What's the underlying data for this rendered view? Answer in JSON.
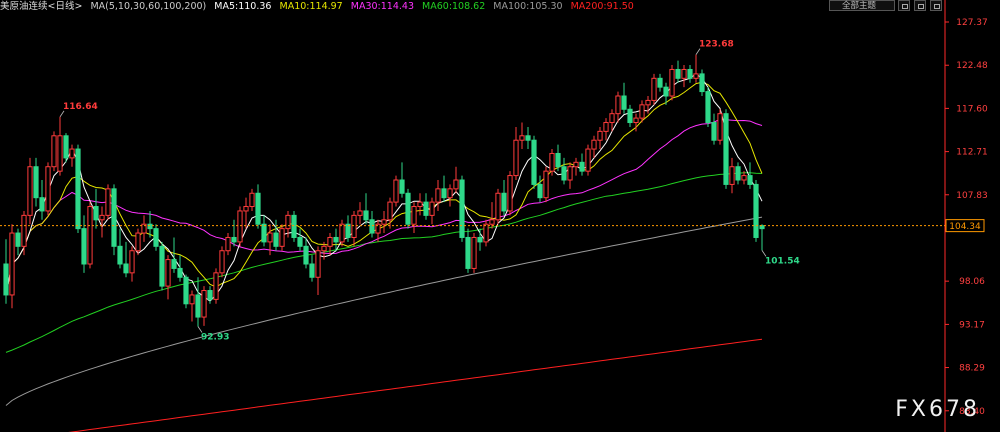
{
  "header": {
    "symbol": "美原油连续",
    "period": "<日线>",
    "ma_params": "MA(5,10,30,60,100,200)",
    "ma5": "MA5:110.36",
    "ma10": "MA10:114.97",
    "ma30": "MA30:114.43",
    "ma60": "MA60:108.62",
    "ma100": "MA100:105.30",
    "ma200": "MA200:91.50"
  },
  "toolbar": {
    "theme_label": "全部主题"
  },
  "watermark": "FX678",
  "colors": {
    "up": "#ff3b3b",
    "down": "#2fd98a",
    "ma5": "#ffffff",
    "ma10": "#e6e600",
    "ma30": "#ff33ff",
    "ma60": "#22d022",
    "ma100": "#9a9a9a",
    "ma200": "#ff2020",
    "current_line": "#ff9900",
    "axis_text": "#ff4040"
  },
  "chart_data": {
    "type": "candlestick",
    "y_axis_ticks": [
      127.37,
      122.48,
      117.6,
      112.71,
      107.83,
      98.06,
      93.17,
      88.29,
      83.4
    ],
    "ylim": [
      81.0,
      128.5
    ],
    "current_price": 104.34,
    "annotations": [
      {
        "label": "116.64",
        "index": 9,
        "kind": "high"
      },
      {
        "label": "92.93",
        "index": 32,
        "kind": "low"
      },
      {
        "label": "123.68",
        "index": 115,
        "kind": "high"
      },
      {
        "label": "101.54",
        "index": 126,
        "kind": "low"
      }
    ],
    "candles": [
      [
        100.0,
        102.8,
        95.5,
        96.5
      ],
      [
        96.5,
        104.5,
        95.0,
        103.5
      ],
      [
        103.5,
        104.0,
        101.0,
        102.0
      ],
      [
        102.0,
        106.0,
        101.0,
        105.5
      ],
      [
        105.5,
        112.0,
        104.5,
        111.0
      ],
      [
        111.0,
        112.0,
        106.5,
        107.5
      ],
      [
        107.5,
        109.5,
        105.0,
        106.0
      ],
      [
        106.0,
        111.5,
        105.5,
        111.0
      ],
      [
        111.0,
        115.0,
        110.5,
        114.5
      ],
      [
        110.5,
        116.64,
        110.0,
        114.5
      ],
      [
        114.5,
        114.8,
        111.5,
        112.0
      ],
      [
        112.0,
        113.5,
        111.0,
        113.0
      ],
      [
        113.0,
        113.5,
        103.5,
        104.0
      ],
      [
        104.0,
        105.5,
        99.0,
        100.0
      ],
      [
        100.0,
        107.0,
        99.5,
        106.5
      ],
      [
        106.5,
        108.5,
        104.0,
        105.0
      ],
      [
        105.0,
        106.5,
        103.0,
        105.5
      ],
      [
        105.5,
        109.0,
        105.0,
        108.5
      ],
      [
        108.5,
        109.0,
        101.0,
        102.0
      ],
      [
        102.0,
        104.0,
        99.5,
        100.0
      ],
      [
        100.0,
        102.5,
        98.5,
        99.0
      ],
      [
        99.0,
        102.0,
        98.0,
        101.5
      ],
      [
        101.5,
        104.0,
        101.0,
        103.5
      ],
      [
        103.5,
        105.5,
        102.5,
        104.5
      ],
      [
        104.5,
        106.0,
        103.0,
        104.0
      ],
      [
        104.0,
        104.5,
        101.5,
        102.0
      ],
      [
        102.0,
        102.5,
        97.0,
        97.5
      ],
      [
        97.5,
        101.0,
        96.0,
        100.5
      ],
      [
        100.5,
        103.0,
        99.0,
        99.5
      ],
      [
        99.5,
        101.0,
        98.0,
        98.5
      ],
      [
        98.5,
        98.8,
        95.0,
        95.5
      ],
      [
        95.5,
        97.0,
        93.5,
        96.5
      ],
      [
        96.5,
        98.5,
        92.93,
        94.0
      ],
      [
        94.0,
        97.5,
        93.0,
        97.0
      ],
      [
        97.0,
        97.5,
        95.5,
        96.0
      ],
      [
        96.0,
        99.5,
        95.5,
        99.0
      ],
      [
        99.0,
        102.0,
        98.5,
        101.5
      ],
      [
        101.5,
        103.5,
        101.0,
        103.0
      ],
      [
        103.0,
        105.0,
        102.0,
        102.5
      ],
      [
        102.5,
        106.5,
        102.0,
        106.0
      ],
      [
        106.0,
        107.5,
        104.0,
        106.5
      ],
      [
        106.5,
        108.5,
        106.0,
        108.0
      ],
      [
        108.0,
        109.0,
        104.0,
        104.5
      ],
      [
        104.5,
        105.5,
        102.0,
        102.5
      ],
      [
        102.5,
        104.5,
        101.0,
        103.5
      ],
      [
        103.5,
        105.0,
        101.5,
        102.0
      ],
      [
        102.0,
        104.5,
        101.5,
        104.0
      ],
      [
        104.0,
        106.0,
        103.0,
        105.5
      ],
      [
        105.5,
        106.0,
        102.5,
        103.0
      ],
      [
        103.0,
        104.0,
        101.5,
        102.0
      ],
      [
        102.0,
        103.0,
        99.5,
        100.0
      ],
      [
        100.0,
        101.0,
        98.0,
        98.5
      ],
      [
        98.5,
        102.0,
        96.5,
        101.5
      ],
      [
        101.5,
        102.5,
        100.5,
        102.0
      ],
      [
        102.0,
        103.5,
        101.0,
        103.0
      ],
      [
        103.0,
        104.0,
        101.5,
        102.5
      ],
      [
        102.5,
        105.0,
        102.0,
        104.5
      ],
      [
        104.5,
        105.5,
        102.5,
        103.0
      ],
      [
        103.0,
        106.0,
        102.0,
        105.5
      ],
      [
        105.5,
        107.0,
        104.5,
        106.0
      ],
      [
        106.0,
        108.0,
        104.5,
        105.0
      ],
      [
        105.0,
        106.0,
        103.0,
        103.5
      ],
      [
        103.5,
        105.0,
        102.5,
        104.5
      ],
      [
        104.5,
        106.0,
        103.5,
        105.0
      ],
      [
        105.0,
        107.5,
        104.0,
        107.0
      ],
      [
        107.0,
        110.0,
        106.5,
        109.5
      ],
      [
        109.5,
        111.5,
        107.5,
        108.0
      ],
      [
        108.0,
        108.5,
        104.0,
        104.5
      ],
      [
        104.5,
        107.0,
        103.5,
        106.5
      ],
      [
        106.5,
        108.0,
        105.5,
        107.0
      ],
      [
        107.0,
        108.0,
        105.0,
        105.5
      ],
      [
        105.5,
        107.5,
        104.5,
        107.0
      ],
      [
        107.0,
        109.5,
        106.0,
        108.5
      ],
      [
        108.5,
        110.0,
        107.0,
        107.5
      ],
      [
        107.5,
        109.0,
        106.5,
        108.5
      ],
      [
        108.5,
        111.0,
        108.0,
        109.5
      ],
      [
        109.5,
        110.0,
        102.5,
        103.0
      ],
      [
        103.0,
        104.0,
        99.0,
        99.5
      ],
      [
        99.5,
        103.5,
        99.0,
        103.0
      ],
      [
        103.0,
        104.0,
        101.5,
        102.5
      ],
      [
        102.5,
        105.0,
        102.0,
        104.5
      ],
      [
        104.5,
        107.0,
        104.0,
        105.0
      ],
      [
        105.0,
        108.5,
        104.5,
        108.0
      ],
      [
        108.0,
        109.5,
        105.5,
        106.0
      ],
      [
        106.0,
        110.5,
        105.5,
        110.0
      ],
      [
        110.0,
        115.5,
        109.5,
        114.0
      ],
      [
        114.0,
        116.0,
        113.0,
        114.5
      ],
      [
        114.5,
        115.5,
        113.0,
        114.0
      ],
      [
        114.0,
        114.5,
        108.5,
        109.0
      ],
      [
        109.0,
        110.0,
        107.0,
        107.5
      ],
      [
        107.5,
        111.0,
        107.0,
        110.5
      ],
      [
        110.5,
        113.0,
        110.0,
        112.5
      ],
      [
        112.5,
        113.5,
        110.5,
        111.0
      ],
      [
        111.0,
        112.0,
        109.0,
        109.5
      ],
      [
        109.5,
        111.5,
        108.5,
        111.0
      ],
      [
        111.0,
        112.0,
        110.0,
        111.5
      ],
      [
        111.5,
        112.5,
        110.0,
        110.5
      ],
      [
        110.5,
        113.5,
        110.0,
        113.0
      ],
      [
        113.0,
        114.5,
        112.0,
        114.0
      ],
      [
        114.0,
        115.5,
        113.0,
        115.0
      ],
      [
        115.0,
        116.5,
        114.0,
        116.0
      ],
      [
        116.0,
        117.5,
        115.0,
        117.0
      ],
      [
        117.0,
        119.5,
        116.0,
        119.0
      ],
      [
        119.0,
        120.5,
        117.0,
        117.5
      ],
      [
        117.5,
        118.0,
        115.5,
        116.0
      ],
      [
        116.0,
        117.0,
        115.0,
        116.5
      ],
      [
        116.5,
        118.5,
        116.0,
        118.0
      ],
      [
        118.0,
        119.0,
        117.0,
        118.5
      ],
      [
        118.5,
        121.5,
        118.0,
        121.0
      ],
      [
        121.0,
        121.5,
        119.5,
        120.0
      ],
      [
        120.0,
        120.5,
        118.0,
        119.0
      ],
      [
        119.0,
        122.5,
        118.5,
        122.0
      ],
      [
        122.0,
        123.0,
        120.5,
        121.0
      ],
      [
        121.0,
        122.5,
        120.0,
        122.0
      ],
      [
        122.0,
        122.5,
        120.5,
        121.0
      ],
      [
        121.0,
        123.68,
        120.5,
        121.5
      ],
      [
        121.5,
        122.0,
        119.0,
        119.5
      ],
      [
        119.5,
        120.0,
        115.5,
        116.0
      ],
      [
        116.0,
        117.0,
        113.5,
        114.0
      ],
      [
        114.0,
        117.5,
        113.5,
        117.0
      ],
      [
        117.0,
        117.5,
        108.5,
        109.0
      ],
      [
        109.0,
        112.0,
        108.0,
        111.0
      ],
      [
        111.0,
        111.5,
        109.0,
        109.5
      ],
      [
        109.5,
        110.5,
        109.0,
        110.0
      ],
      [
        110.0,
        111.5,
        108.5,
        109.0
      ],
      [
        109.0,
        109.5,
        102.5,
        103.0
      ],
      [
        104.34,
        104.5,
        101.54,
        104.0
      ]
    ]
  }
}
